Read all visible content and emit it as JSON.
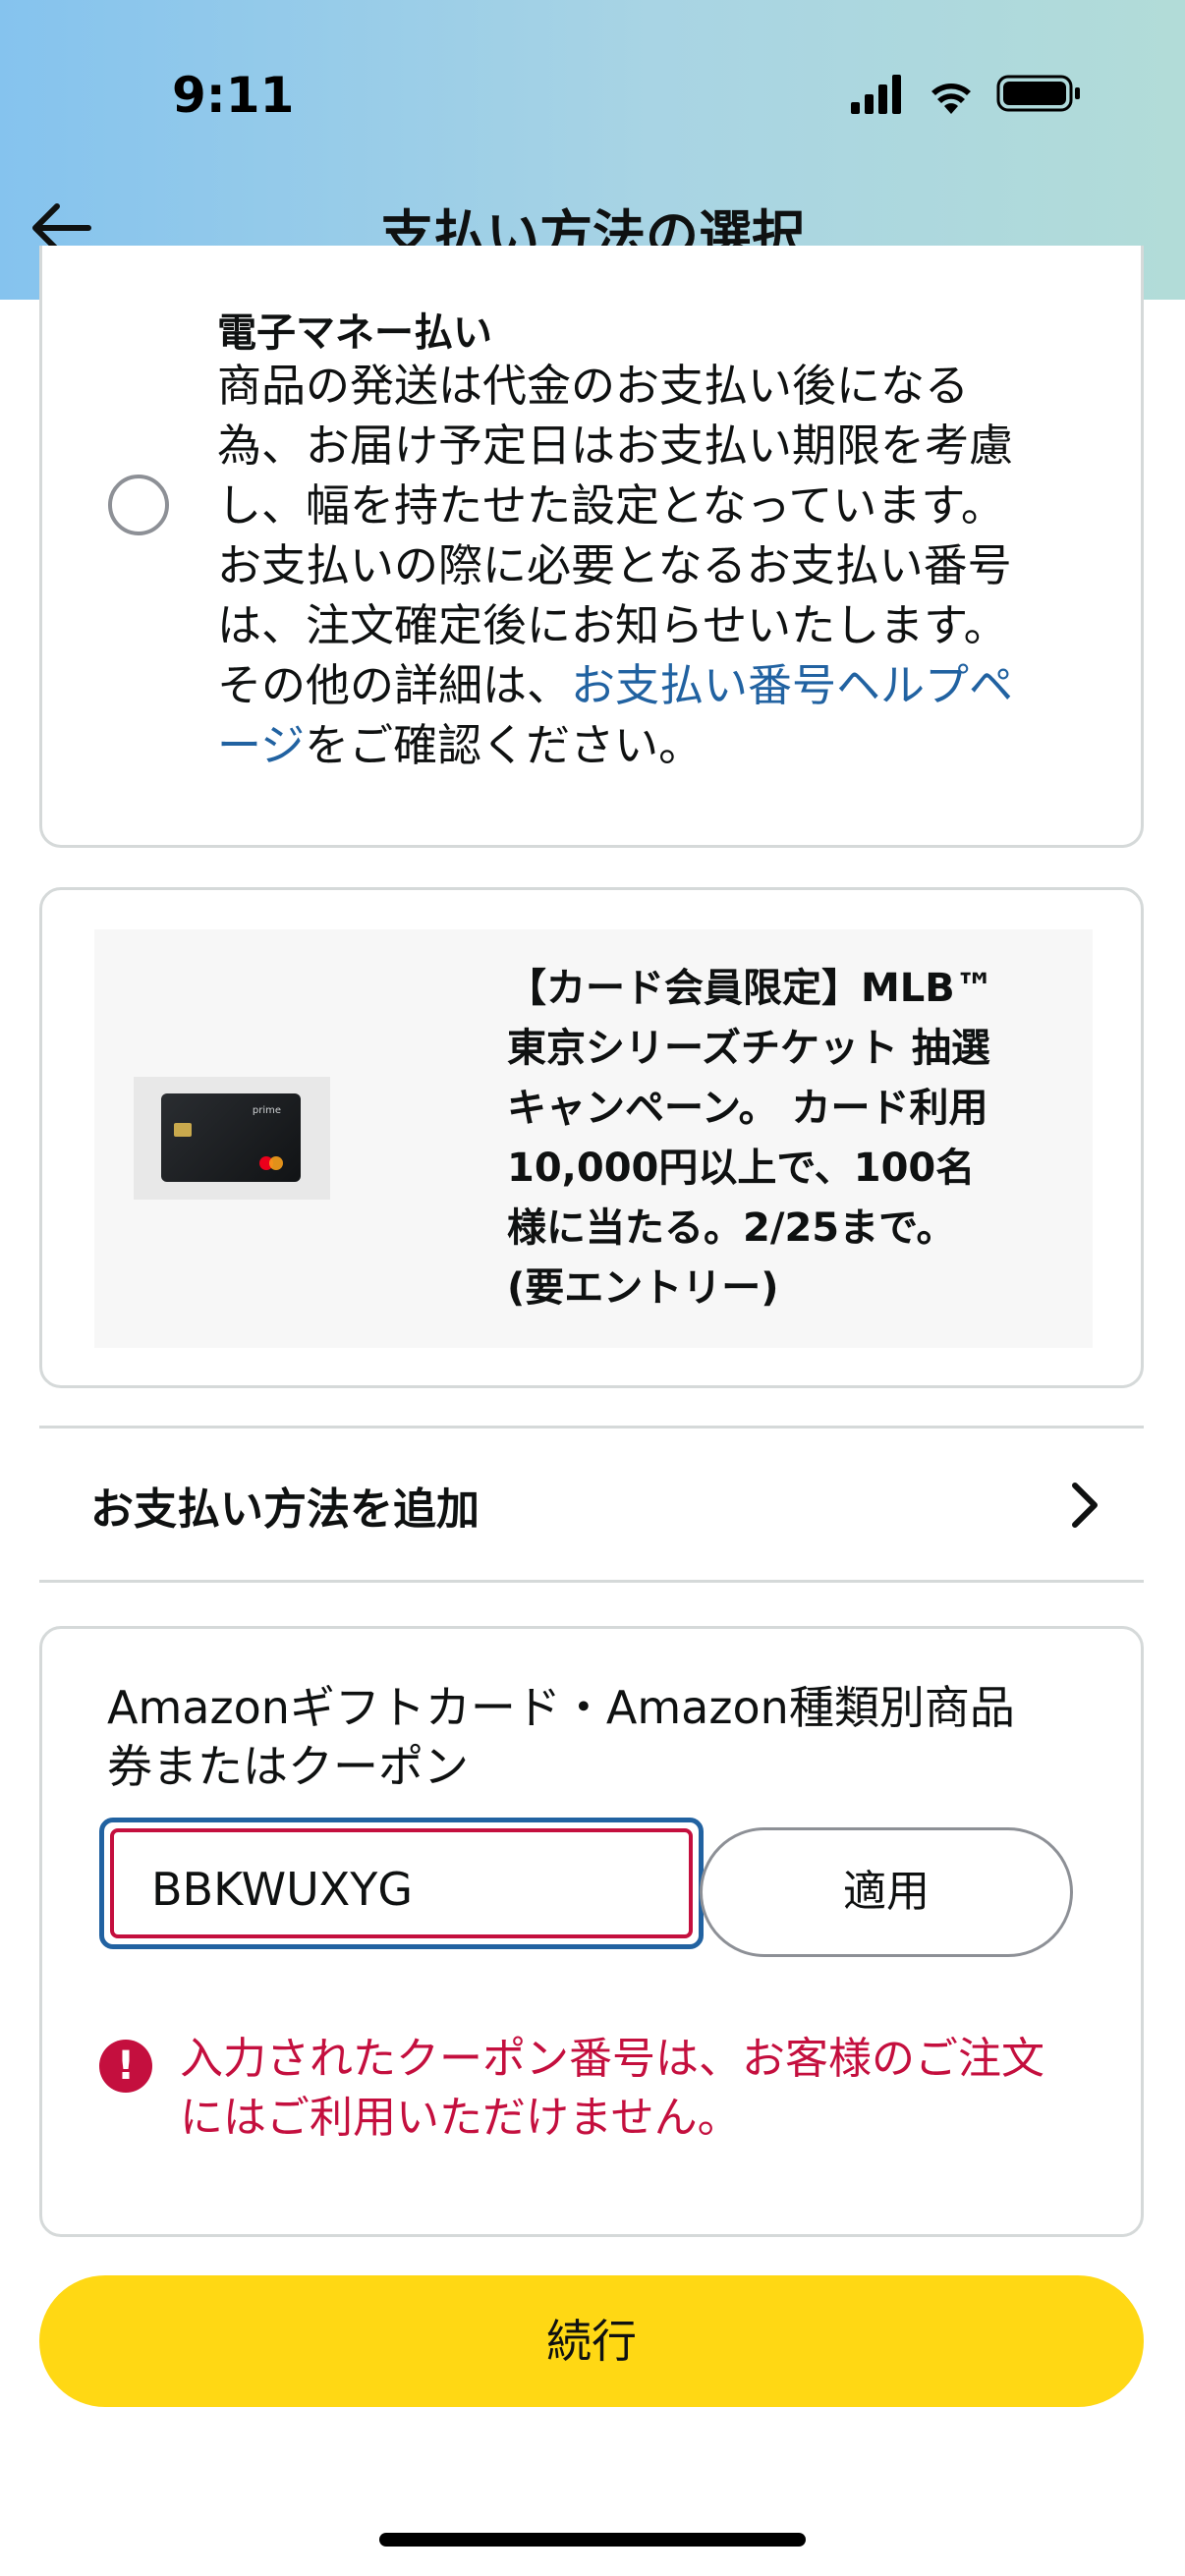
{
  "status_bar": {
    "time": "9:11"
  },
  "header": {
    "title": "支払い方法の選択",
    "back_icon": "arrow-left-icon"
  },
  "emoney": {
    "title": "電子マネー払い",
    "lines": [
      "商品の発送は代金のお支払い後になる",
      "為、お届け予定日はお支払い期限を考慮",
      "し、幅を持たせた設定となっています。",
      "お支払いの際に必要となるお支払い番号",
      "は、注文確定後にお知らせいたします。"
    ],
    "details_prefix": "その他の詳細は、",
    "help_link": "お支払い番号ヘルプペ",
    "help_link_2": "ージ",
    "details_suffix": "をご確認ください。",
    "selected": false
  },
  "promo": {
    "lines": [
      "【カード会員限定】MLB™",
      "東京シリーズチケット 抽選",
      "キャンペーン。 カード利用",
      "10,000円以上で、100名",
      "様に当たる。2/25まで。",
      "(要エントリー)"
    ],
    "card_logo": "prime"
  },
  "add_payment": {
    "label": "お支払い方法を追加",
    "icon": "chevron-right-icon"
  },
  "coupon": {
    "label_line1": "Amazonギフトカード・Amazon種類別商品",
    "label_line2": "券またはクーポン",
    "input_value": "BBKWUXYG",
    "apply_label": "適用",
    "error_line1": "入力されたクーポン番号は、お客様のご注文",
    "error_line2": "にはご利用いただけません。",
    "error_icon": "!"
  },
  "continue_label": "続行",
  "colors": {
    "accent_yellow": "#ffd814",
    "error_red": "#c40f3e",
    "link_blue": "#2162a1"
  }
}
